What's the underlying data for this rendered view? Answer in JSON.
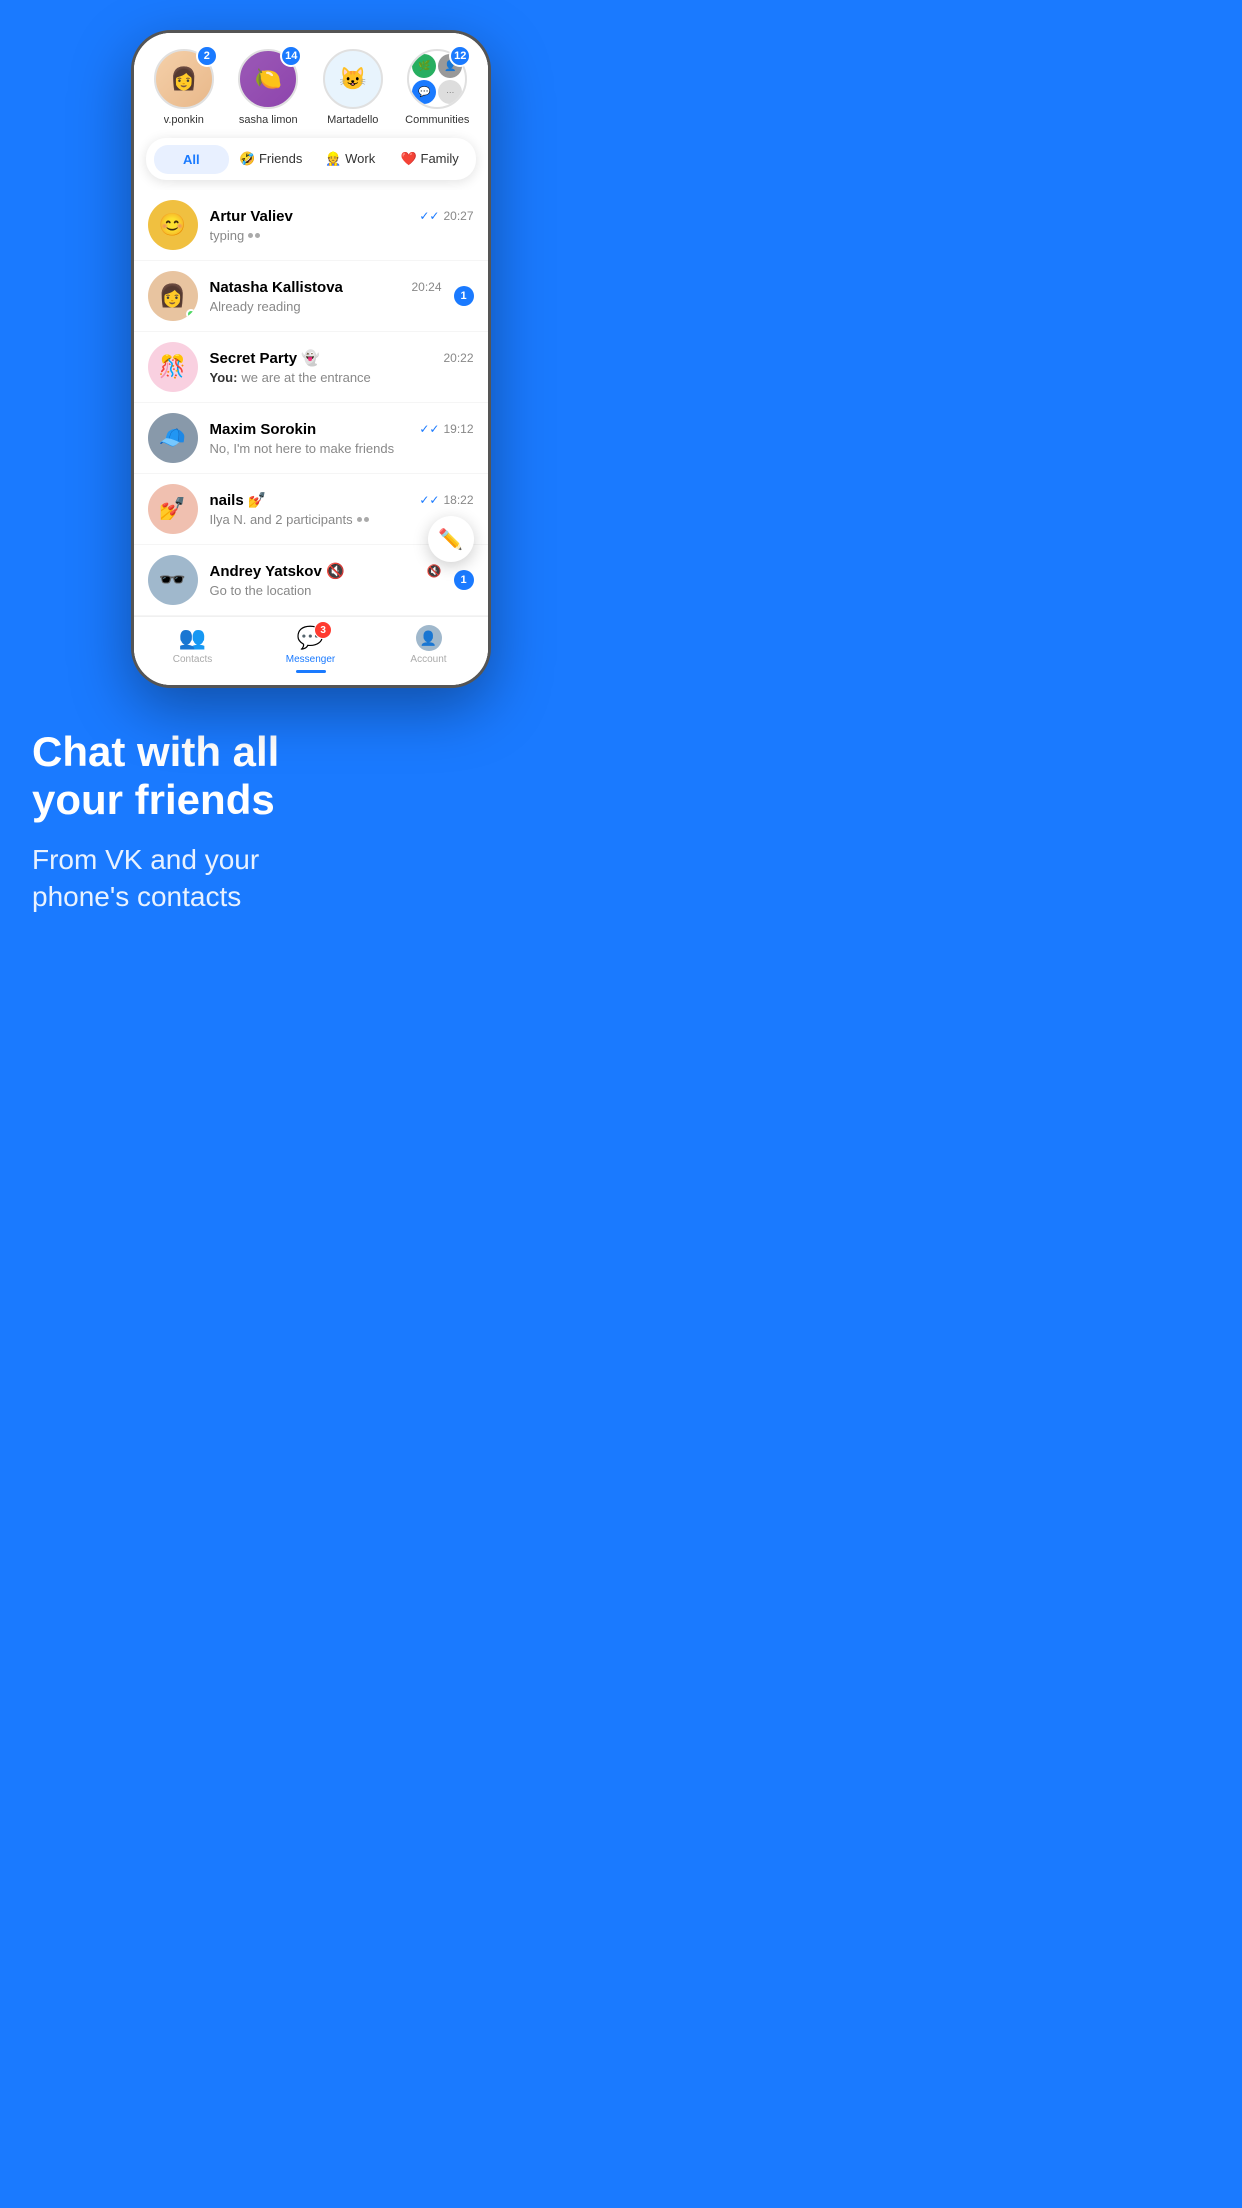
{
  "background_color": "#1a7aff",
  "stories": [
    {
      "id": "ponkin",
      "name": "v.ponkin",
      "badge": "2",
      "emoji": "👩"
    },
    {
      "id": "limon",
      "name": "sasha limon",
      "badge": "14",
      "emoji": "🍋"
    },
    {
      "id": "martadello",
      "name": "Martadello",
      "badge": null,
      "emoji": "🐱"
    },
    {
      "id": "communities",
      "name": "Communities",
      "badge": "12",
      "emoji": null
    }
  ],
  "filter_tabs": [
    {
      "id": "all",
      "label": "All",
      "active": true
    },
    {
      "id": "friends",
      "label": "🤣 Friends",
      "active": false
    },
    {
      "id": "work",
      "label": "👷 Work",
      "active": false
    },
    {
      "id": "family",
      "label": "❤️ Family",
      "active": false
    }
  ],
  "chats": [
    {
      "id": "artur",
      "name": "Artur Valiev",
      "preview": "typing",
      "time": "20:27",
      "has_check": true,
      "unread": null,
      "muted": false,
      "online": false,
      "typing": true
    },
    {
      "id": "natasha",
      "name": "Natasha Kallistova",
      "preview": "Already reading",
      "time": "20:24",
      "has_check": false,
      "unread": "1",
      "muted": false,
      "online": true,
      "typing": false
    },
    {
      "id": "secret",
      "name": "Secret Party 👻",
      "preview": "we are at the entrance",
      "time": "20:22",
      "has_check": false,
      "unread": null,
      "muted": false,
      "online": false,
      "typing": false,
      "you_prefix": "You:"
    },
    {
      "id": "maxim",
      "name": "Maxim Sorokin",
      "preview": "No, I'm not here to make friends",
      "time": "19:12",
      "has_check": true,
      "unread": null,
      "muted": false,
      "online": false,
      "typing": false
    },
    {
      "id": "nails",
      "name": "nails 💅",
      "preview": "Ilya N. and 2 participants",
      "time": "18:22",
      "has_check": true,
      "unread": null,
      "muted": false,
      "online": false,
      "typing": true
    },
    {
      "id": "andrey",
      "name": "Andrey Yatskov 🔇",
      "preview": "Go to the location",
      "time": "",
      "has_check": false,
      "unread": "1",
      "muted": true,
      "online": false,
      "typing": false
    }
  ],
  "bottom_nav": {
    "contacts_label": "Contacts",
    "messenger_label": "Messenger",
    "account_label": "Account",
    "messenger_badge": "3"
  },
  "headline": "Chat with all\nyour friends",
  "subheadline": "From VK and your\nphone's contacts"
}
